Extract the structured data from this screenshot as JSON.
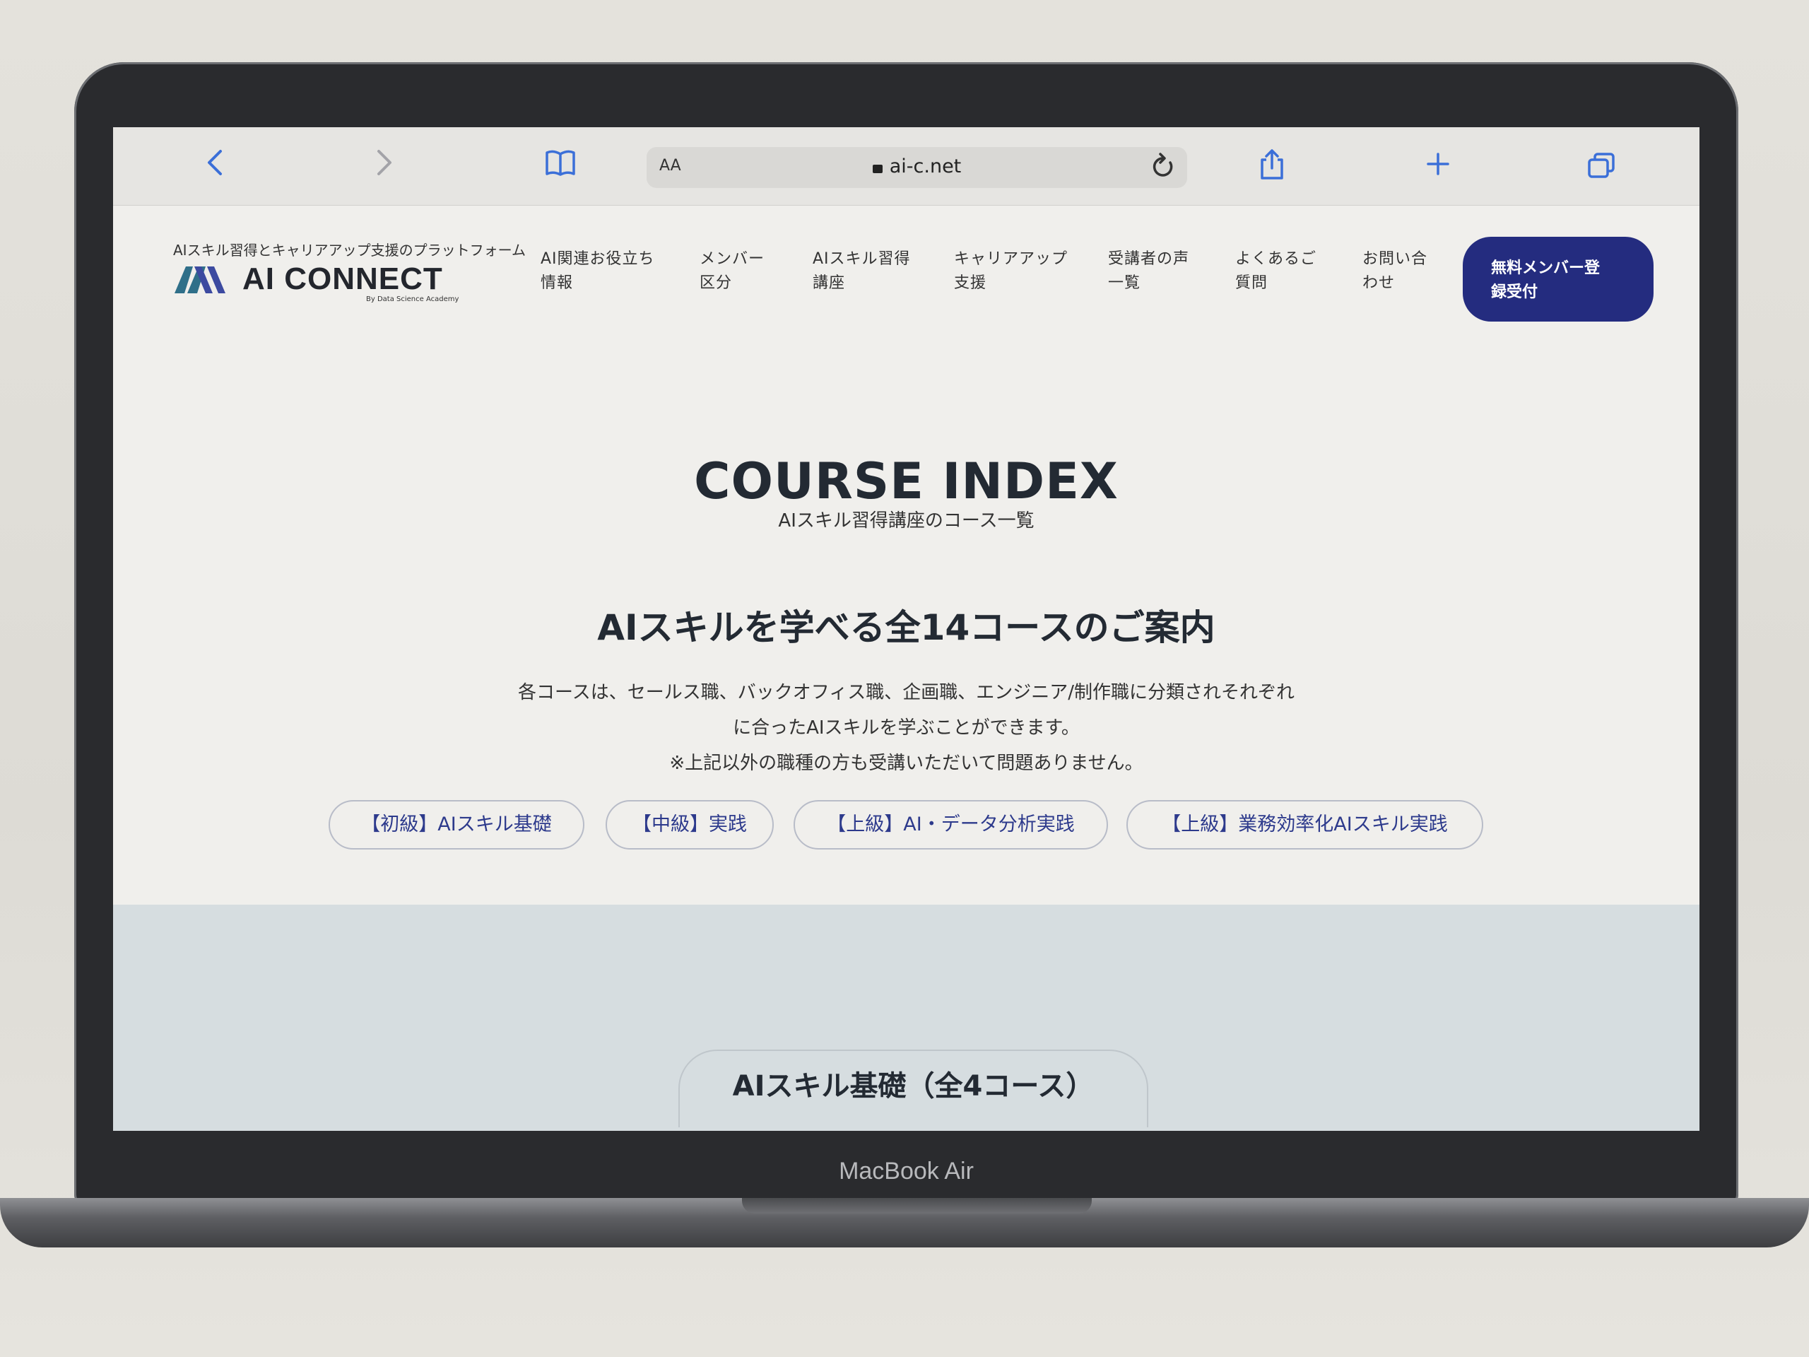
{
  "device": {
    "label": "MacBook Air"
  },
  "browser": {
    "aa_label": "AA",
    "url": "ai-c.net",
    "icons": [
      "chevron-left-icon",
      "chevron-right-icon",
      "book-icon",
      "reload-icon",
      "share-icon",
      "plus-icon",
      "tabs-icon"
    ]
  },
  "header": {
    "tagline": "AIスキル習得とキャリアアップ支援のプラットフォーム",
    "logo_text": "AI CONNECT",
    "logo_sub": "By Data Science Academy",
    "nav": [
      {
        "line1": "AI関連お役立ち",
        "line2": "情報"
      },
      {
        "line1": "メンバー",
        "line2": "区分"
      },
      {
        "line1": "AIスキル習得",
        "line2": "講座"
      },
      {
        "line1": "キャリアアップ",
        "line2": "支援"
      },
      {
        "line1": "受講者の声",
        "line2": "一覧"
      },
      {
        "line1": "よくあるご",
        "line2": "質問"
      },
      {
        "line1": "お問い合",
        "line2": "わせ"
      }
    ],
    "cta": {
      "line1": "無料メンバー登",
      "line2": "録受付"
    },
    "brand_color": "#242c7f"
  },
  "hero": {
    "title": "COURSE INDEX",
    "subtitle": "AIスキル習得講座のコース一覧",
    "heading": "AIスキルを学べる全14コースのご案内",
    "desc": [
      "各コースは、セールス職、バックオフィス職、企画職、エンジニア/制作職に分類されそれぞれ",
      "に合ったAIスキルを学ぶことができます。",
      "※上記以外の職種の方も受講いただいて問題ありません。"
    ]
  },
  "levels": [
    "【初級】AIスキル基礎",
    "【中級】実践",
    "【上級】AI・データ分析実践",
    "【上級】業務効率化AIスキル実践"
  ],
  "section": {
    "title": "AIスキル基礎（全4コース）"
  }
}
